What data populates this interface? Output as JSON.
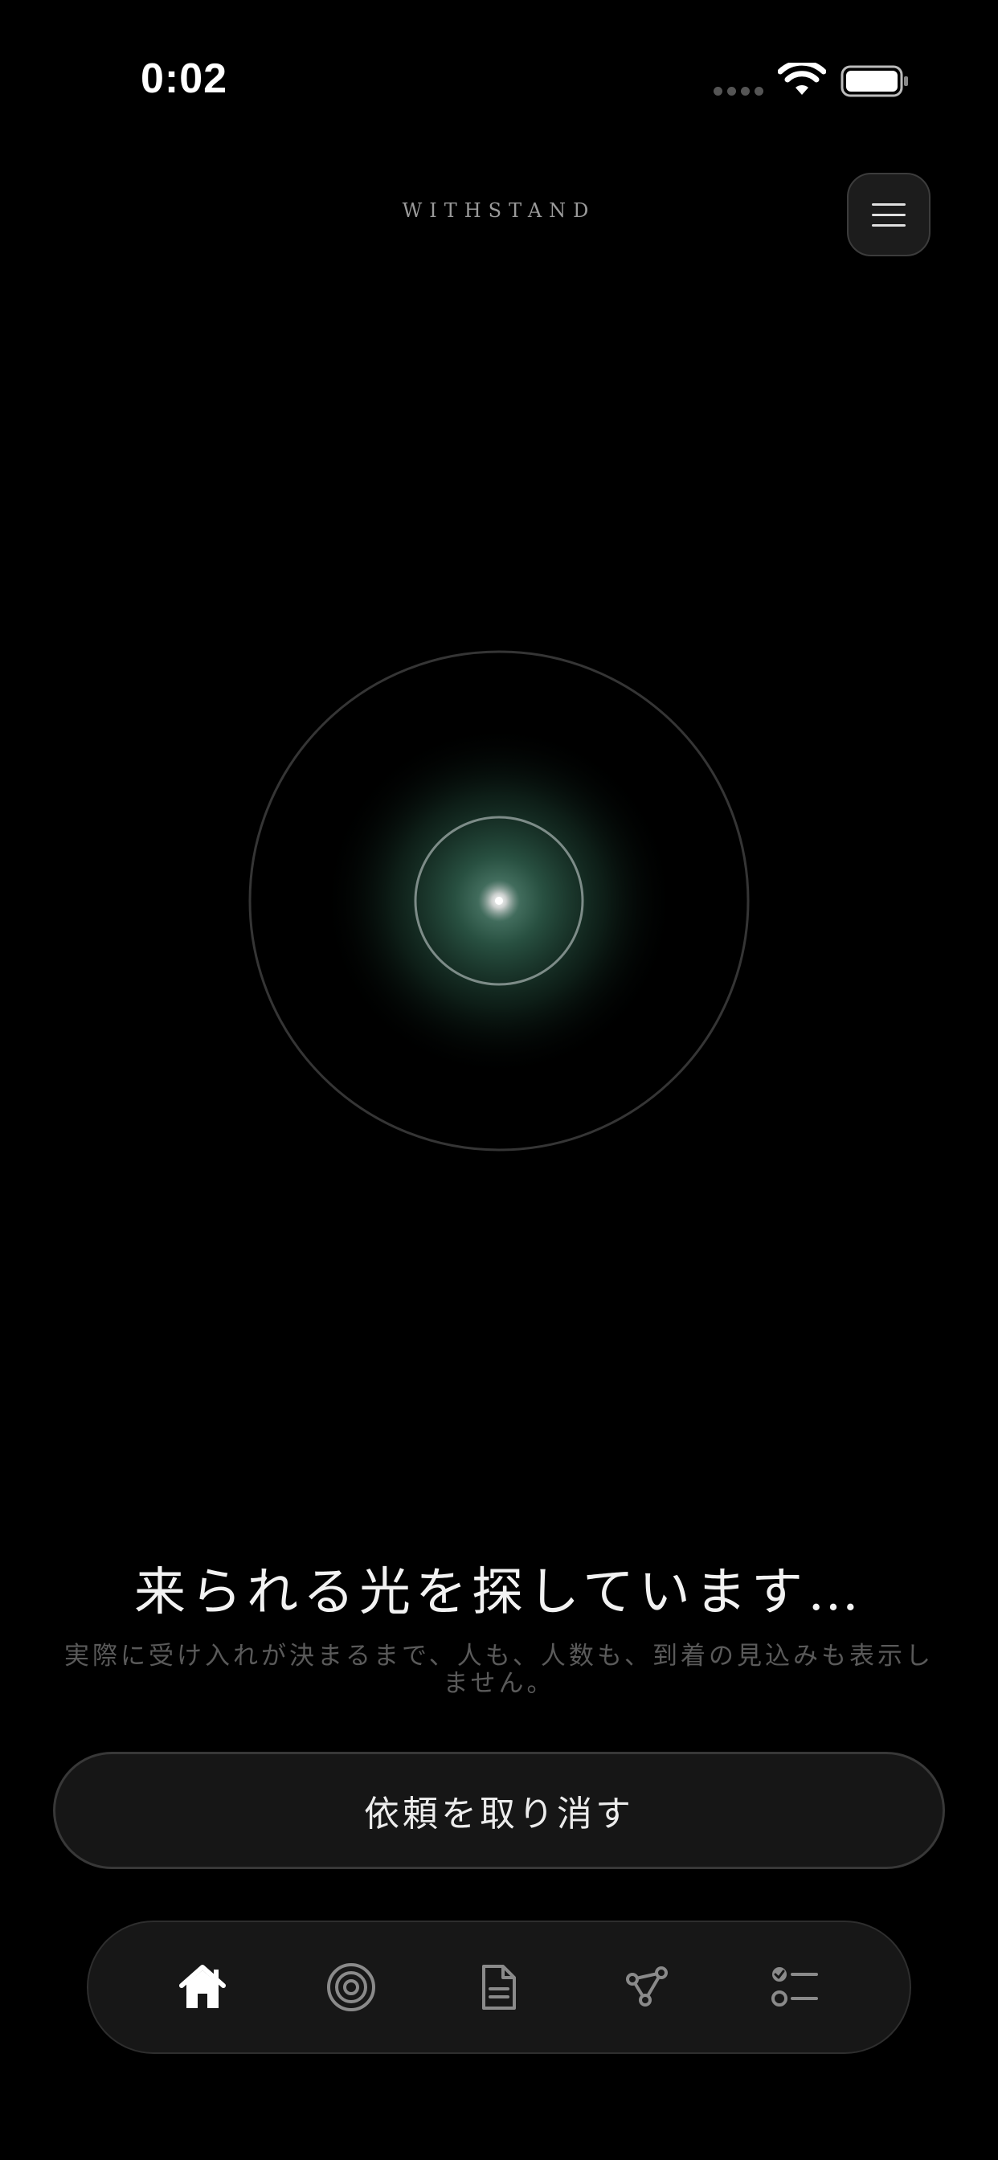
{
  "status_bar": {
    "time": "0:02"
  },
  "header": {
    "brand": "WITHSTAND"
  },
  "main": {
    "headline": "来られる光を探しています…",
    "subtext": "実際に受け入れが決まるまで、人も、人数も、到着の見込みも表示しません。",
    "cancel_label": "依頼を取り消す"
  },
  "tabbar": {
    "tabs": [
      {
        "icon": "home-icon",
        "active": true
      },
      {
        "icon": "target-icon",
        "active": false
      },
      {
        "icon": "document-icon",
        "active": false
      },
      {
        "icon": "network-icon",
        "active": false
      },
      {
        "icon": "checklist-icon",
        "active": false
      }
    ]
  },
  "colors": {
    "background": "#000000",
    "glow": "#2f5e4c",
    "ring": "#3a3a3a",
    "inner_ring": "#7a8a86"
  }
}
